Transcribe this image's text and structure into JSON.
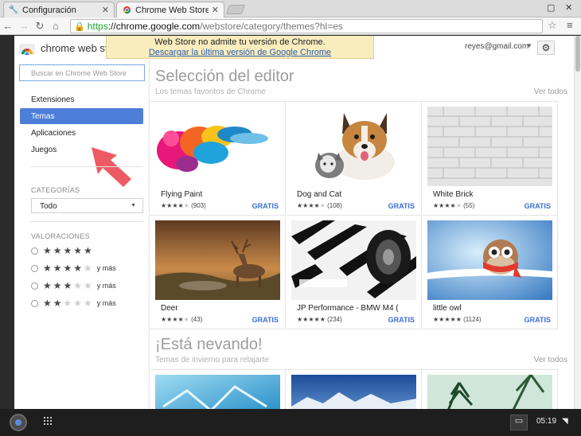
{
  "browser": {
    "tabs": [
      {
        "title": "Configuración",
        "icon": "wrench-icon",
        "active": false
      },
      {
        "title": "Chrome Web Store - Tem",
        "icon": "webstore-icon",
        "active": true
      }
    ],
    "close_glyph": "✕",
    "url_https": "https",
    "url_host": "://chrome.google.com",
    "url_path": "/webstore/category/themes?hl=es"
  },
  "header": {
    "title": "chrome web sto",
    "user_email": "reyes@gmail.com"
  },
  "infobar": {
    "message": "Web Store no admite tu versión de Chrome.",
    "link": "Descargar la última versión de Google Chrome"
  },
  "sidebar": {
    "search_placeholder": "Buscar en Chrome Web Store",
    "nav": [
      {
        "label": "Extensiones",
        "selected": false
      },
      {
        "label": "Temas",
        "selected": true
      },
      {
        "label": "Aplicaciones",
        "selected": false
      },
      {
        "label": "Juegos",
        "selected": false
      }
    ],
    "categories_label": "CATEGORÍAS",
    "category_selected": "Todo",
    "ratings_label": "VALORACIONES",
    "ratings": [
      {
        "stars": 5,
        "suffix": ""
      },
      {
        "stars": 4,
        "suffix": "y más"
      },
      {
        "stars": 3,
        "suffix": "y más"
      },
      {
        "stars": 2,
        "suffix": "y más"
      }
    ]
  },
  "sections": [
    {
      "title": "Selección del editor",
      "subtitle": "Los temas favoritos de Chrome",
      "see_all": "Ver todos",
      "items": [
        {
          "name": "Flying Paint",
          "rating": 4,
          "count": "(903)",
          "price": "GRATIS"
        },
        {
          "name": "Dog and Cat",
          "rating": 4,
          "count": "(108)",
          "price": "GRATIS"
        },
        {
          "name": "White Brick",
          "rating": 4,
          "count": "(55)",
          "price": "GRATIS"
        },
        {
          "name": "Deer",
          "rating": 4,
          "count": "(43)",
          "price": "GRATIS"
        },
        {
          "name": "JP Performance - BMW M4 (unoffi...",
          "rating": 5,
          "count": "(234)",
          "price": "GRATIS"
        },
        {
          "name": "little owl",
          "rating": 5,
          "count": "(1124)",
          "price": "GRATIS"
        }
      ]
    },
    {
      "title": "¡Está nevando!",
      "subtitle": "Temas de invierno para relajarte",
      "see_all": "Ver todos"
    }
  ],
  "shelf": {
    "time": "05:19"
  }
}
